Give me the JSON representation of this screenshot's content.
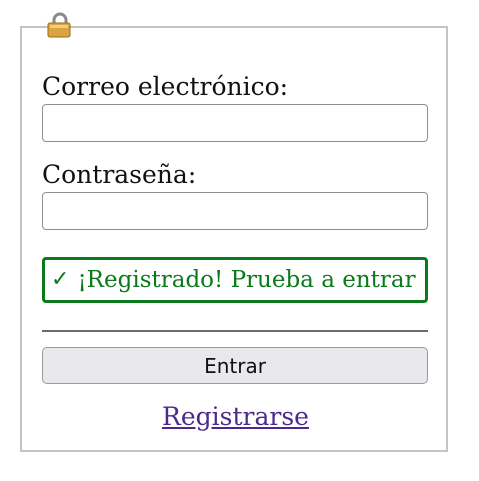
{
  "form": {
    "email_label": "Correo electrónico:",
    "email_value": "",
    "password_label": "Contraseña:",
    "password_value": "",
    "success_check": "✓",
    "success_message": "¡Registrado! Prueba a entrar",
    "submit_label": "Entrar",
    "register_link": "Registrarse"
  },
  "icons": {
    "header": "lock-icon"
  },
  "colors": {
    "success": "#0b7a1a",
    "link": "#4b2a8f",
    "button_bg": "#e9e9ed",
    "panel_border": "#c4c4c4"
  }
}
